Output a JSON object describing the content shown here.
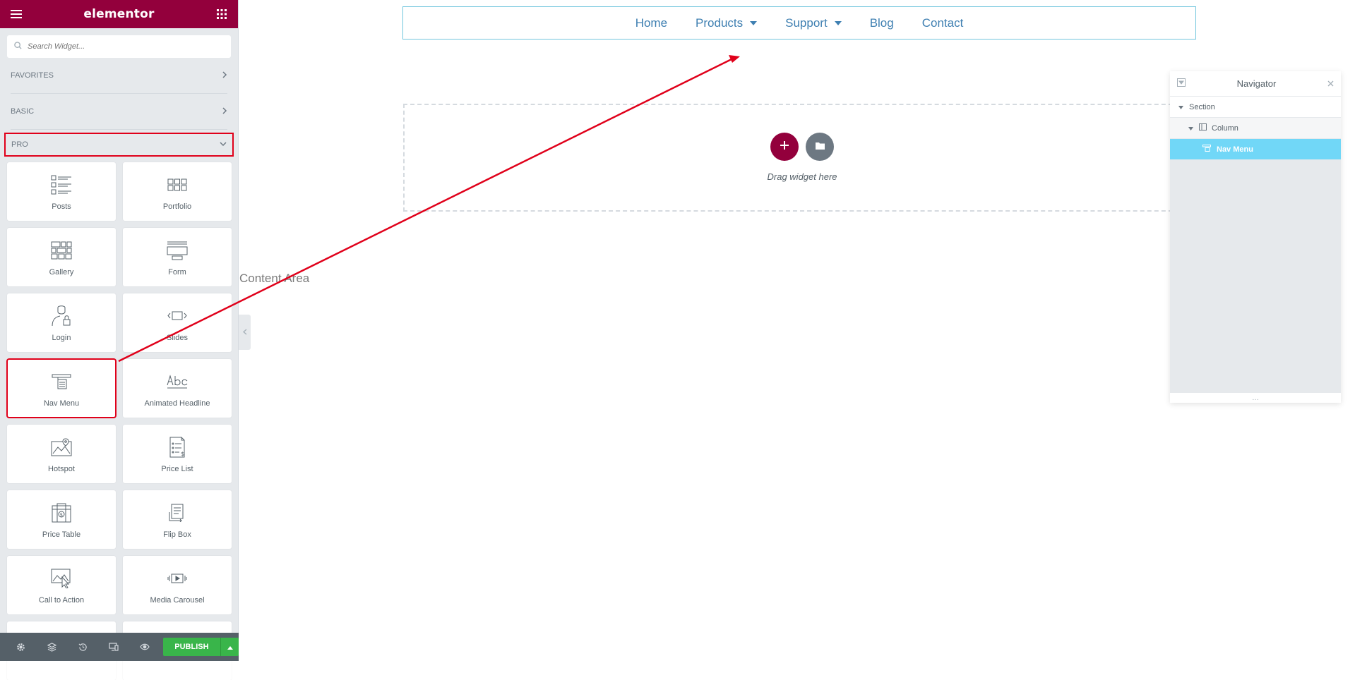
{
  "panel": {
    "brand": "elementor",
    "search_placeholder": "Search Widget...",
    "categories": {
      "favorites": "FAVORITES",
      "basic": "BASIC",
      "pro": "PRO"
    },
    "widgets": [
      {
        "label": "Posts",
        "icon": "posts-icon"
      },
      {
        "label": "Portfolio",
        "icon": "portfolio-icon"
      },
      {
        "label": "Gallery",
        "icon": "gallery-icon"
      },
      {
        "label": "Form",
        "icon": "form-icon"
      },
      {
        "label": "Login",
        "icon": "login-icon"
      },
      {
        "label": "Slides",
        "icon": "slides-icon"
      },
      {
        "label": "Nav Menu",
        "icon": "nav-menu-icon"
      },
      {
        "label": "Animated Headline",
        "icon": "animated-headline-icon"
      },
      {
        "label": "Hotspot",
        "icon": "hotspot-icon"
      },
      {
        "label": "Price List",
        "icon": "price-list-icon"
      },
      {
        "label": "Price Table",
        "icon": "price-table-icon"
      },
      {
        "label": "Flip Box",
        "icon": "flip-box-icon"
      },
      {
        "label": "Call to Action",
        "icon": "call-to-action-icon"
      },
      {
        "label": "Media Carousel",
        "icon": "media-carousel-icon"
      }
    ],
    "footer": {
      "publish_label": "PUBLISH"
    }
  },
  "canvas": {
    "menu_items": [
      "Home",
      "Products",
      "Support",
      "Blog",
      "Contact"
    ],
    "drag_text": "Drag widget here",
    "content_area_label": "Content Area"
  },
  "navigator": {
    "title": "Navigator",
    "tree": {
      "section": "Section",
      "column": "Column",
      "widget": "Nav Menu"
    }
  },
  "colors": {
    "brand": "#93003c",
    "highlight": "#e0001a",
    "menu_link": "#3e7fb1",
    "publish": "#39b54a",
    "navigator_active": "#71d7f7"
  }
}
